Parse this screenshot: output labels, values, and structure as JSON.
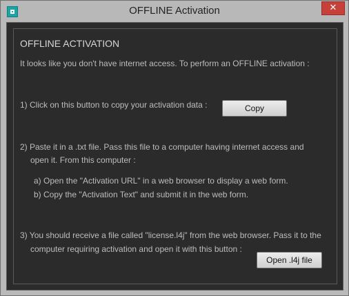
{
  "window": {
    "title": "OFFLINE Activation",
    "close_glyph": "✕",
    "accent_close": "#c7413b"
  },
  "content": {
    "heading": "OFFLINE ACTIVATION",
    "intro": "It looks like you don't have internet access. To perform an OFFLINE activation :",
    "step1": "1) Click on this button to copy your activation data :",
    "copy_button": "Copy",
    "step2_line1": "2) Paste it in a  .txt file. Pass this file to a computer having internet access and",
    "step2_line2": "open it. From this computer :",
    "step2a": "a) Open the \"Activation URL\"  in a web browser to display a web form.",
    "step2b": "b) Copy the \"Activation Text\" and submit it in the web form.",
    "step3_line1": "3) You should receive a file called \"license.l4j\" from the web browser. Pass it to the",
    "step3_line2": "computer requiring activation and open it with this button :",
    "open_button": "Open .l4j file"
  },
  "icons": {
    "app": "app-icon",
    "close": "close-icon"
  }
}
